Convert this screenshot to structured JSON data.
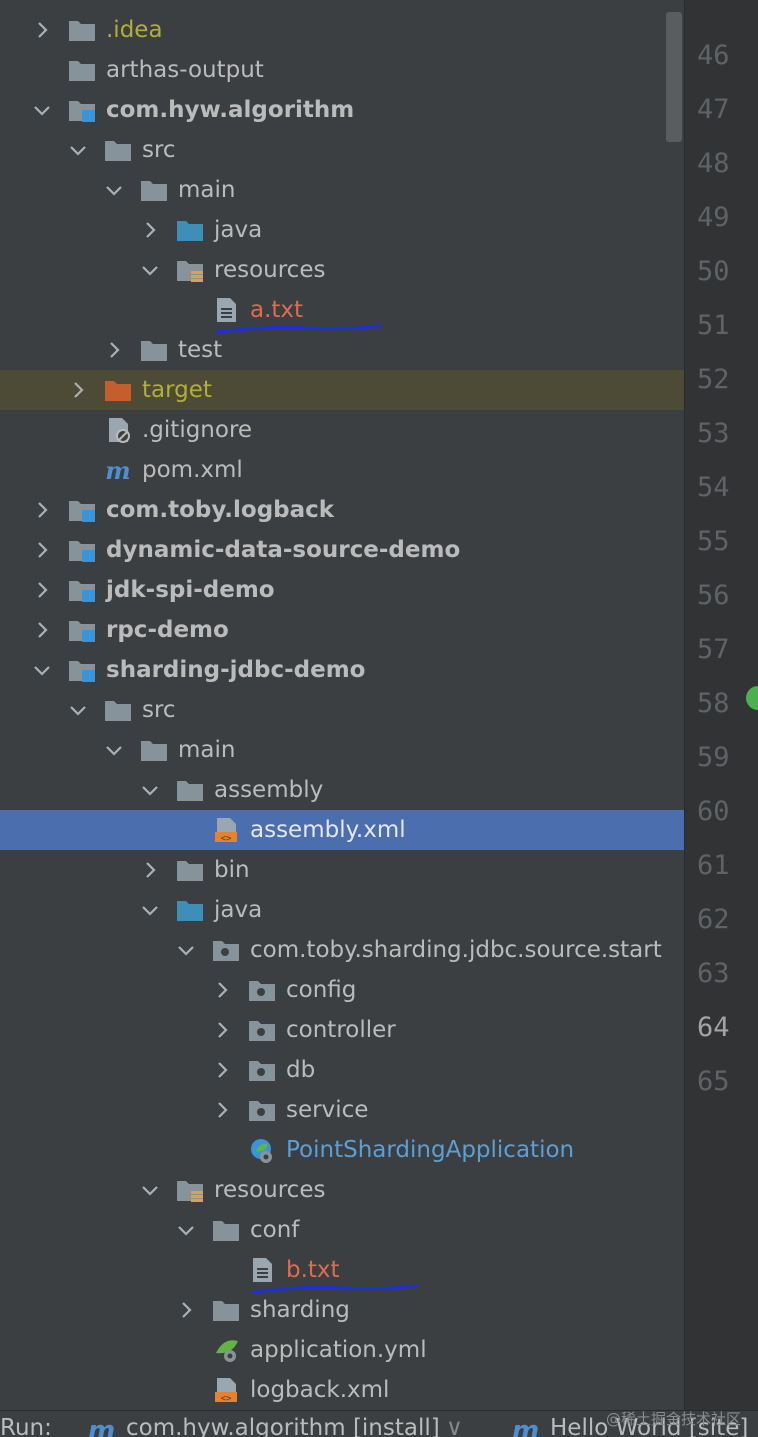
{
  "project_tree": [
    {
      "label": ".idea",
      "depth": 0,
      "chevron": "right",
      "icon": "folder",
      "style": "olive"
    },
    {
      "label": "arthas-output",
      "depth": 0,
      "chevron": "none",
      "icon": "folder",
      "style": "normal"
    },
    {
      "label": "com.hyw.algorithm",
      "depth": 0,
      "chevron": "down",
      "icon": "module",
      "style": "bold"
    },
    {
      "label": "src",
      "depth": 1,
      "chevron": "down",
      "icon": "folder",
      "style": "normal"
    },
    {
      "label": "main",
      "depth": 2,
      "chevron": "down",
      "icon": "folder",
      "style": "normal"
    },
    {
      "label": "java",
      "depth": 3,
      "chevron": "right",
      "icon": "source-folder",
      "style": "normal"
    },
    {
      "label": "resources",
      "depth": 3,
      "chevron": "down",
      "icon": "resources-folder",
      "style": "normal"
    },
    {
      "label": "a.txt",
      "depth": 4,
      "chevron": "none",
      "icon": "text-file",
      "style": "orange",
      "underline": true
    },
    {
      "label": "test",
      "depth": 2,
      "chevron": "right",
      "icon": "folder",
      "style": "normal"
    },
    {
      "label": "target",
      "depth": 1,
      "chevron": "right",
      "icon": "excluded-folder",
      "style": "olive",
      "highlight": "dark"
    },
    {
      "label": ".gitignore",
      "depth": 1,
      "chevron": "none",
      "icon": "ignore-file",
      "style": "normal"
    },
    {
      "label": "pom.xml",
      "depth": 1,
      "chevron": "none",
      "icon": "maven-file",
      "style": "normal"
    },
    {
      "label": "com.toby.logback",
      "depth": 0,
      "chevron": "right",
      "icon": "module",
      "style": "bold"
    },
    {
      "label": "dynamic-data-source-demo",
      "depth": 0,
      "chevron": "right",
      "icon": "module",
      "style": "bold"
    },
    {
      "label": "jdk-spi-demo",
      "depth": 0,
      "chevron": "right",
      "icon": "module",
      "style": "bold"
    },
    {
      "label": "rpc-demo",
      "depth": 0,
      "chevron": "right",
      "icon": "module",
      "style": "bold"
    },
    {
      "label": "sharding-jdbc-demo",
      "depth": 0,
      "chevron": "down",
      "icon": "module",
      "style": "bold"
    },
    {
      "label": "src",
      "depth": 1,
      "chevron": "down",
      "icon": "folder",
      "style": "normal"
    },
    {
      "label": "main",
      "depth": 2,
      "chevron": "down",
      "icon": "folder",
      "style": "normal"
    },
    {
      "label": "assembly",
      "depth": 3,
      "chevron": "down",
      "icon": "folder",
      "style": "normal"
    },
    {
      "label": "assembly.xml",
      "depth": 4,
      "chevron": "none",
      "icon": "xml-file",
      "style": "white",
      "highlight": "selected"
    },
    {
      "label": "bin",
      "depth": 3,
      "chevron": "right",
      "icon": "folder",
      "style": "normal"
    },
    {
      "label": "java",
      "depth": 3,
      "chevron": "down",
      "icon": "source-folder",
      "style": "normal"
    },
    {
      "label": "com.toby.sharding.jdbc.source.start",
      "depth": 4,
      "chevron": "down",
      "icon": "package",
      "style": "normal"
    },
    {
      "label": "config",
      "depth": 5,
      "chevron": "right",
      "icon": "package",
      "style": "normal"
    },
    {
      "label": "controller",
      "depth": 5,
      "chevron": "right",
      "icon": "package",
      "style": "normal"
    },
    {
      "label": "db",
      "depth": 5,
      "chevron": "right",
      "icon": "package",
      "style": "normal"
    },
    {
      "label": "service",
      "depth": 5,
      "chevron": "right",
      "icon": "package",
      "style": "normal"
    },
    {
      "label": "PointShardingApplication",
      "depth": 5,
      "chevron": "none",
      "icon": "spring-app",
      "style": "blue"
    },
    {
      "label": "resources",
      "depth": 3,
      "chevron": "down",
      "icon": "resources-folder",
      "style": "normal"
    },
    {
      "label": "conf",
      "depth": 4,
      "chevron": "down",
      "icon": "folder",
      "style": "normal"
    },
    {
      "label": "b.txt",
      "depth": 5,
      "chevron": "none",
      "icon": "text-file",
      "style": "orange",
      "underline": true
    },
    {
      "label": "sharding",
      "depth": 4,
      "chevron": "right",
      "icon": "folder",
      "style": "normal"
    },
    {
      "label": "application.yml",
      "depth": 4,
      "chevron": "none",
      "icon": "spring-config",
      "style": "normal"
    },
    {
      "label": "logback.xml",
      "depth": 4,
      "chevron": "none",
      "icon": "xml-file",
      "style": "normal"
    }
  ],
  "gutter": {
    "line_numbers": [
      "46",
      "47",
      "48",
      "49",
      "50",
      "51",
      "52",
      "53",
      "54",
      "55",
      "56",
      "57",
      "58",
      "59",
      "60",
      "61",
      "62",
      "63",
      "64",
      "65"
    ],
    "current_line": "64"
  },
  "run_bar": {
    "label": "Run:",
    "tab1": "com.hyw.algorithm [install]",
    "tab2": "Hello World [site]"
  },
  "watermark": "@稀土掘金技术社区",
  "colors": {
    "tree_background": "#3c3f41",
    "gutter_background": "#313335",
    "selection": "#4b6eaf",
    "excluded_highlight": "#4d4a36",
    "underline_annotation": "#1e2ed8"
  }
}
